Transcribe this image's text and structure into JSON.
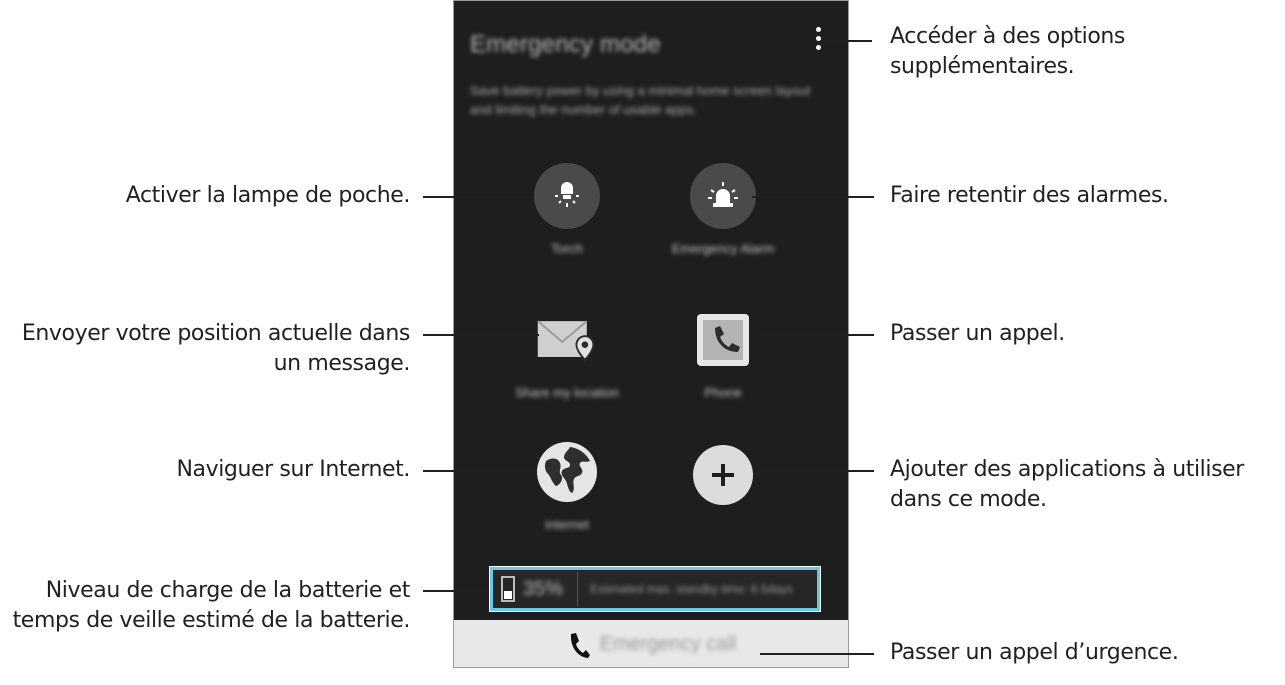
{
  "phone": {
    "title": "Emergency mode",
    "description": "Save battery power by using a minimal home screen layout and limiting the number of usable apps.",
    "apps": [
      {
        "label": "Torch",
        "icon": "torch-icon"
      },
      {
        "label": "Emergency Alarm",
        "icon": "alarm-icon"
      },
      {
        "label": "Share my location",
        "icon": "share-location-icon"
      },
      {
        "label": "Phone",
        "icon": "phone-app-icon"
      },
      {
        "label": "Internet",
        "icon": "globe-icon"
      },
      {
        "label": "",
        "icon": "add-icon"
      }
    ],
    "battery": {
      "percent": "35%",
      "estimate": "Estimated max. standby time: 6.5days",
      "level": 0.35
    },
    "emergency_call": "Emergency call",
    "accent_color": "#6cc6e8"
  },
  "callouts": {
    "more_options": "Accéder à des options supplémentaires.",
    "torch": "Activer la lampe de poche.",
    "alarm": "Faire retentir des alarmes.",
    "share_location": "Envoyer votre position actuelle dans un message.",
    "phone": "Passer un appel.",
    "internet": "Naviguer sur Internet.",
    "add_apps": "Ajouter des applications à utiliser dans ce mode.",
    "battery": "Niveau de charge de la batterie et temps de veille estimé de la batterie.",
    "emergency_call": "Passer un appel d’urgence."
  }
}
